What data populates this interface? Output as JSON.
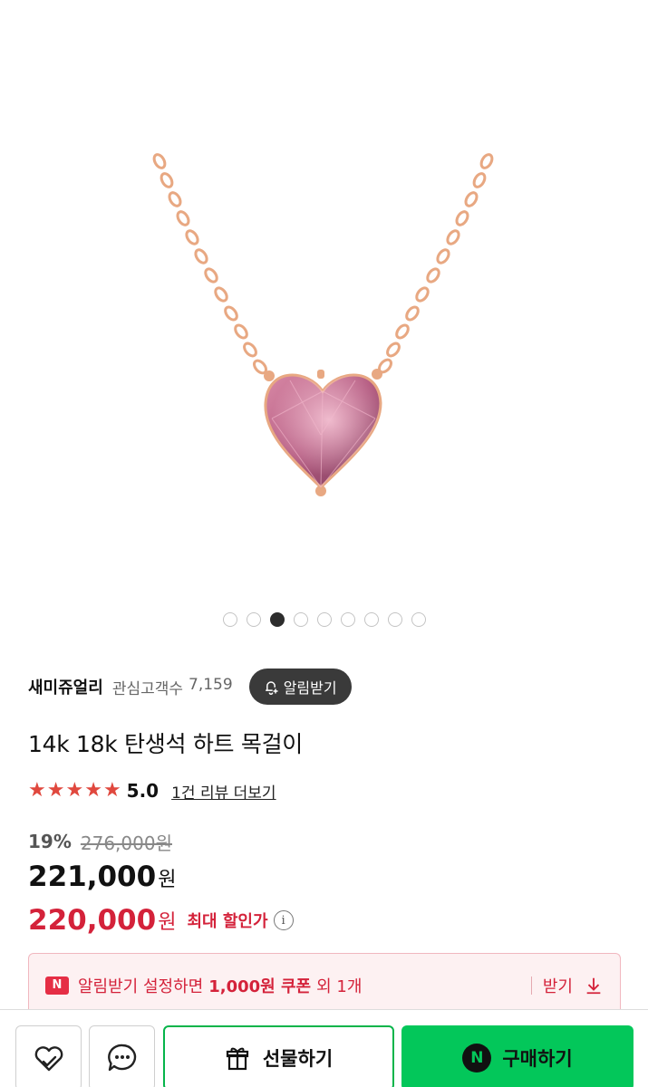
{
  "image_carousel": {
    "total": 9,
    "active_index": 2
  },
  "seller": {
    "name": "새미쥬얼리",
    "watchers_label": "관심고객수",
    "watchers_count": "7,159",
    "alarm_label": "알림받기"
  },
  "product": {
    "title": "14k 18k 탄생석 하트 목걸이",
    "rating_score": "5.0",
    "stars": 5,
    "review_link": "1건 리뷰 더보기"
  },
  "price": {
    "discount_rate": "19%",
    "original": "276,000원",
    "sale_number": "221,000",
    "sale_unit": "원",
    "best_number": "220,000",
    "best_unit": "원",
    "best_label": "최대 할인가",
    "info_glyph": "i"
  },
  "coupon": {
    "badge": "N",
    "text_prefix": "알림받기 설정하면",
    "text_bold": "1,000원 쿠폰",
    "text_suffix": "외 1개",
    "action_label": "받기"
  },
  "bottom_bar": {
    "gift_label": "선물하기",
    "buy_badge": "N",
    "buy_label": "구매하기"
  },
  "colors": {
    "accent_red": "#d4223a",
    "star": "#e0483e",
    "naver_green": "#03c75a",
    "gem_pink": "#b95a82",
    "rose_gold": "#e8a882"
  },
  "icons": {
    "wish": "heart-icon",
    "chat": "chat-bubble-icon",
    "gift": "gift-icon",
    "alarm": "bell-plus-icon",
    "download": "download-icon",
    "info": "info-icon"
  }
}
